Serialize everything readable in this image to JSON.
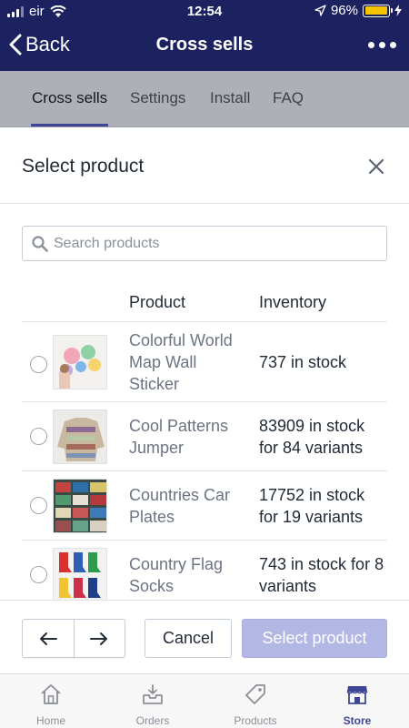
{
  "status_bar": {
    "carrier": "eir",
    "time": "12:54",
    "battery": "96%",
    "battery_level": 0.96
  },
  "nav": {
    "back_label": "Back",
    "title": "Cross sells"
  },
  "tabs": [
    {
      "label": "Cross sells",
      "active": true
    },
    {
      "label": "Settings",
      "active": false
    },
    {
      "label": "Install",
      "active": false
    },
    {
      "label": "FAQ",
      "active": false
    }
  ],
  "modal": {
    "title": "Select product",
    "search_placeholder": "Search products",
    "columns": {
      "product": "Product",
      "inventory": "Inventory"
    },
    "products": [
      {
        "name": "Colorful World Map Wall Sticker",
        "inventory": "737 in stock",
        "image": "world-map-sticker-thumbnail"
      },
      {
        "name": "Cool Patterns Jumper",
        "inventory": "83909 in stock for 84 variants",
        "image": "patterned-jumper-thumbnail"
      },
      {
        "name": "Countries Car Plates",
        "inventory": "17752 in stock for 19 variants",
        "image": "car-plates-thumbnail"
      },
      {
        "name": "Country Flag Socks",
        "inventory": "743 in stock for 8 variants",
        "image": "flag-socks-thumbnail"
      }
    ],
    "footer": {
      "cancel_label": "Cancel",
      "select_label": "Select product"
    }
  },
  "bottom_tabs": [
    {
      "label": "Home",
      "icon": "home-icon",
      "active": false
    },
    {
      "label": "Orders",
      "icon": "orders-icon",
      "active": false
    },
    {
      "label": "Products",
      "icon": "tag-icon",
      "active": false
    },
    {
      "label": "Store",
      "icon": "store-icon",
      "active": true
    }
  ],
  "colors": {
    "nav_bg": "#1c2260",
    "accent": "#3d4695",
    "primary_disabled": "#b3b7e3"
  }
}
